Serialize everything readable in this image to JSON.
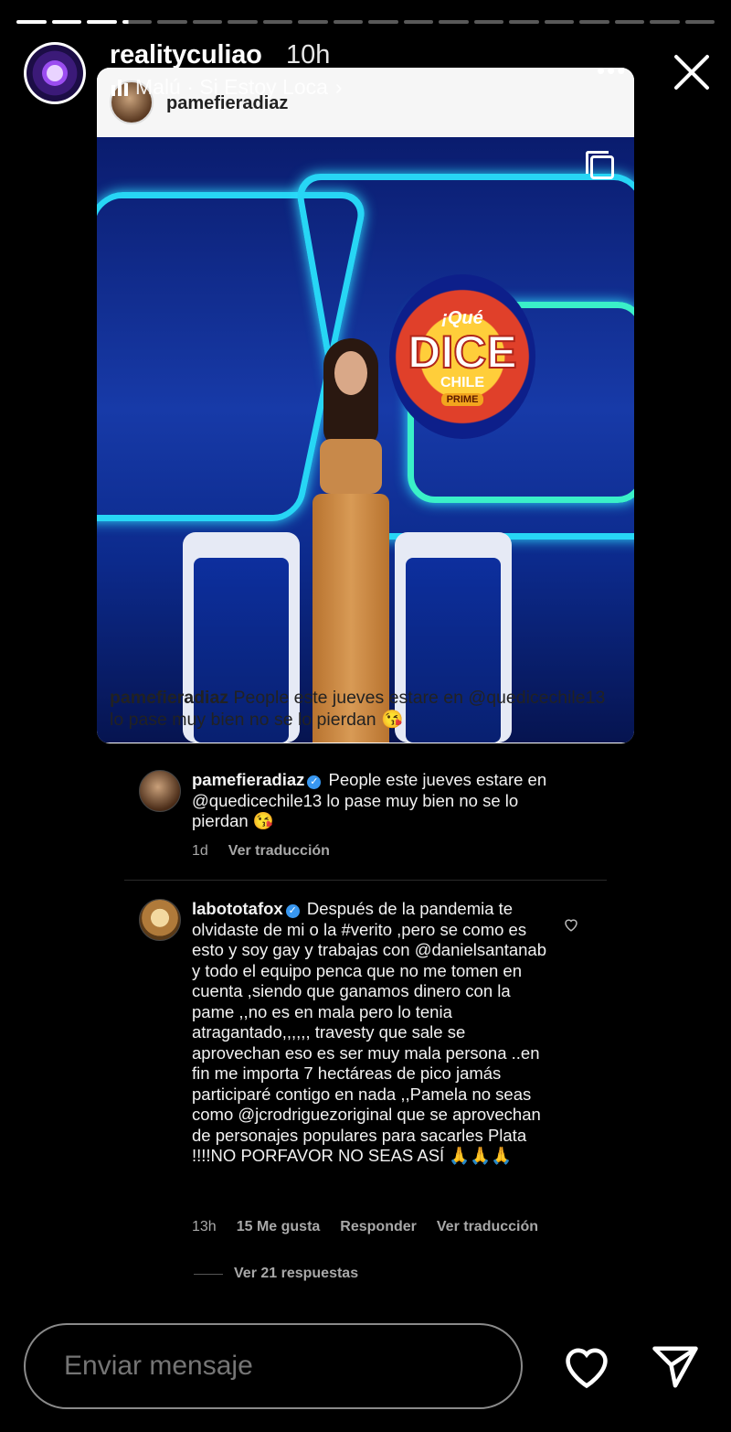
{
  "story": {
    "username": "realityculiao",
    "time_ago": "10h",
    "music": "Malú · Si Estoy Loca",
    "more_label": "•••",
    "progress": {
      "segments": 20,
      "completed": 3,
      "current_fraction": 0.2
    }
  },
  "shared_post": {
    "username": "pamefieradiaz",
    "caption_user": "pamefieradiaz",
    "caption_text": "People este jueves estare en @quedicechile13 lo pase muy bien no se lo pierdan 😘",
    "image_logo": {
      "top": "¡Qué",
      "main": "DICE",
      "sub": "CHILE",
      "badge": "PRIME"
    }
  },
  "comments": [
    {
      "username": "pamefieradiaz",
      "verified": true,
      "text": "People este jueves estare en @quedicechile13 lo pase muy bien no se lo pierdan 😘",
      "time": "1d",
      "translate": "Ver traducción"
    },
    {
      "username": "labototafox",
      "verified": true,
      "text": "Después de la pandemia te olvidaste de mi o la #verito ,pero se como es esto y soy gay y trabajas con @danielsantanab y todo el equipo penca que no me tomen en cuenta ,siendo que ganamos dinero con la pame ,,no es en mala pero lo tenia atragantado,,,,,, travesty que sale se aprovechan eso es ser muy mala persona ..en fin me importa 7 hectáreas de pico jamás participaré contigo en nada ,,Pamela no seas como @jcrodriguezoriginal que se aprovechan de personajes populares para sacarles Plata !!!!NO PORFAVOR NO SEAS ASÍ 🙏🙏🙏",
      "time": "13h",
      "likes": "15 Me gusta",
      "reply": "Responder",
      "translate": "Ver traducción",
      "view_replies": "Ver 21 respuestas"
    }
  ],
  "bottom": {
    "message_placeholder": "Enviar mensaje"
  },
  "icons": {
    "close": "close-icon",
    "heart": "heart-icon",
    "send": "send-icon",
    "verified": "verified-badge-icon",
    "music": "music-bars-icon",
    "carousel": "carousel-icon"
  }
}
